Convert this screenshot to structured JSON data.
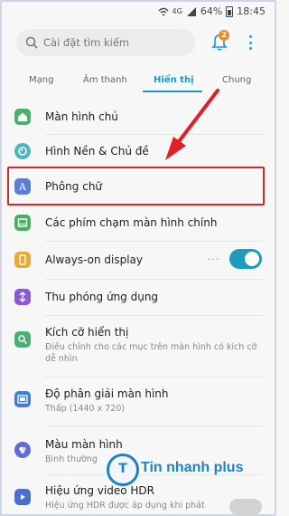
{
  "status_bar": {
    "battery_percent": "64%",
    "time": "18:45",
    "network": "4G"
  },
  "search": {
    "placeholder": "Cài đặt tìm kiếm"
  },
  "notifications": {
    "badge_count": "2"
  },
  "tabs": [
    {
      "label": "Mạng"
    },
    {
      "label": "Âm thanh"
    },
    {
      "label": "Hiển thị"
    },
    {
      "label": "Chung"
    }
  ],
  "active_tab": "Hiển thị",
  "settings": [
    {
      "label": "Màn hình chủ"
    },
    {
      "label": "Hình Nền & Chủ đề"
    },
    {
      "label": "Phông chữ"
    },
    {
      "label": "Các phím chạm màn hình chính"
    },
    {
      "label": "Always-on display",
      "toggle_on": true
    },
    {
      "label": "Thu phóng ứng dụng"
    },
    {
      "label": "Kích cỡ hiển thị",
      "sub": "Điều chỉnh cho các mục trên màn hình có kích cỡ dễ nhìn"
    },
    {
      "label": "Độ phân giải màn hình",
      "sub": "Thấp (1440 x 720)"
    },
    {
      "label": "Màu màn hình",
      "sub": "Bình thường"
    },
    {
      "label": "Hiệu ứng video HDR",
      "sub": "Hiệu ứng HDR được áp dụng khi phát",
      "toggle_on": false
    }
  ],
  "watermark": {
    "text": "Tin nhanh plus",
    "mark": "T"
  },
  "colors": {
    "accent": "#1a9bbf",
    "highlight": "#d9262b",
    "arrow": "#e21f26"
  }
}
